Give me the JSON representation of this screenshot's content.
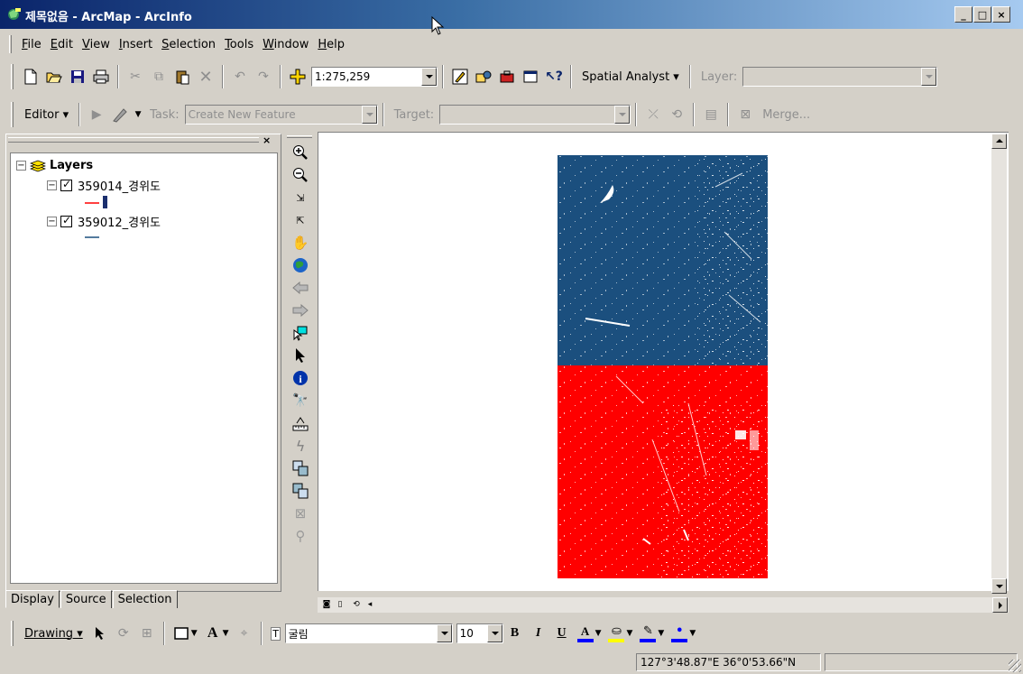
{
  "window": {
    "title": "제목없음 - ArcMap - ArcInfo",
    "controls": {
      "minimize": "_",
      "maximize": "□",
      "close": "×"
    }
  },
  "menu": {
    "items": [
      {
        "label": "File",
        "key": "F"
      },
      {
        "label": "Edit",
        "key": "E"
      },
      {
        "label": "View",
        "key": "V"
      },
      {
        "label": "Insert",
        "key": "I"
      },
      {
        "label": "Selection",
        "key": "S"
      },
      {
        "label": "Tools",
        "key": "T"
      },
      {
        "label": "Window",
        "key": "W"
      },
      {
        "label": "Help",
        "key": "H"
      }
    ]
  },
  "standard_toolbar": {
    "scale_value": "1:275,259",
    "spatial_analyst_label": "Spatial Analyst ▾",
    "layer_label": "Layer:",
    "layer_value": ""
  },
  "editor_toolbar": {
    "editor_label": "Editor ▾",
    "task_label": "Task:",
    "task_value": "Create New Feature",
    "target_label": "Target:",
    "target_value": "",
    "merge_label": "Merge..."
  },
  "toc": {
    "root_label": "Layers",
    "layers": [
      {
        "name": "359014_경위도",
        "checked": true,
        "symbol_color": "#ff0000"
      },
      {
        "name": "359012_경위도",
        "checked": true,
        "symbol_color": "#1b4f7e"
      }
    ],
    "tabs": [
      "Display",
      "Source",
      "Selection"
    ],
    "active_tab": "Display"
  },
  "tools": [
    "zoom-in-icon",
    "zoom-out-icon",
    "fixed-zoom-in-icon",
    "fixed-zoom-out-icon",
    "pan-icon",
    "full-extent-icon",
    "back-extent-icon",
    "forward-extent-icon",
    "select-features-icon",
    "select-elements-icon",
    "identify-icon",
    "find-icon",
    "measure-icon",
    "hyperlink-icon",
    "swipe-icon",
    "transparency-icon",
    "disabled-tool-icon",
    "disabled-tool-2-icon"
  ],
  "map": {
    "layers_colors": {
      "north": "#1b4f7e",
      "south": "#ff0000",
      "background": "#ffffff"
    }
  },
  "drawing_toolbar": {
    "drawing_label": "Drawing ▾",
    "font_name": "굴림",
    "font_size": "10",
    "bold": "B",
    "italic": "I",
    "underline": "U",
    "font_color": "#0000ff",
    "fill_color": "#ffff00",
    "line_color": "#0000ff",
    "marker_color": "#0000ff"
  },
  "status": {
    "coordinates": "127°3'48.87\"E  36°0'53.66\"N"
  }
}
